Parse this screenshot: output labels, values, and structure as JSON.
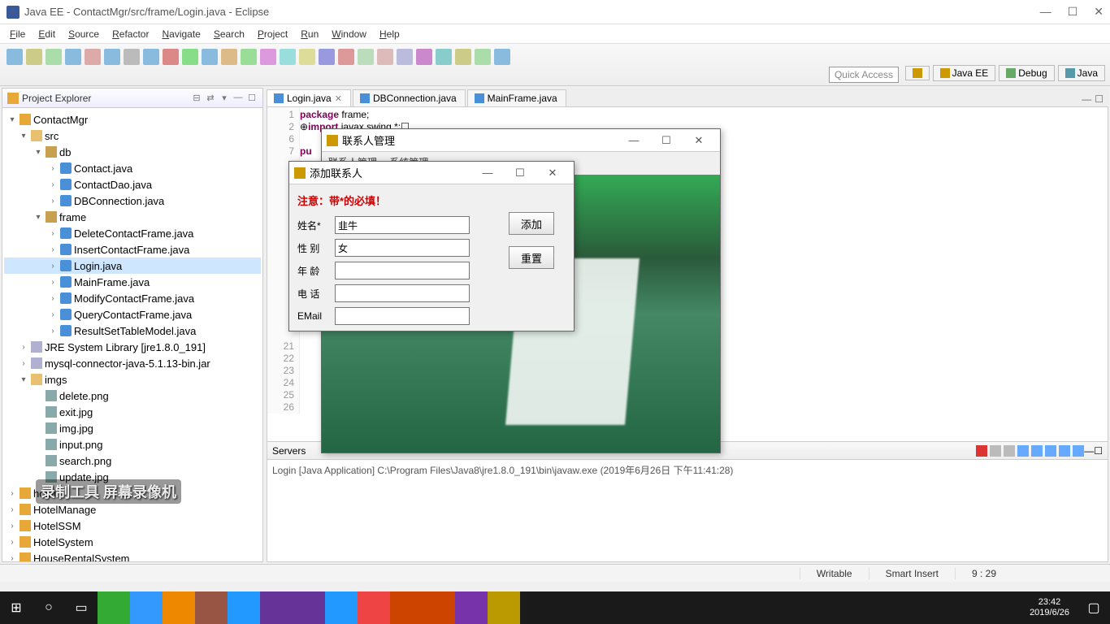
{
  "title": "Java EE - ContactMgr/src/frame/Login.java - Eclipse",
  "menus": [
    "File",
    "Edit",
    "Source",
    "Refactor",
    "Navigate",
    "Search",
    "Project",
    "Run",
    "Window",
    "Help"
  ],
  "quick_access": "Quick Access",
  "perspectives": {
    "javaee": "Java EE",
    "debug": "Debug",
    "java": "Java"
  },
  "explorer": {
    "title": "Project Explorer",
    "tree": [
      {
        "depth": 0,
        "icon": "project",
        "arrow": "▾",
        "label": "ContactMgr"
      },
      {
        "depth": 1,
        "icon": "folder",
        "arrow": "▾",
        "label": "src"
      },
      {
        "depth": 2,
        "icon": "pkg",
        "arrow": "▾",
        "label": "db"
      },
      {
        "depth": 3,
        "icon": "java",
        "arrow": "›",
        "label": "Contact.java"
      },
      {
        "depth": 3,
        "icon": "java",
        "arrow": "›",
        "label": "ContactDao.java"
      },
      {
        "depth": 3,
        "icon": "java",
        "arrow": "›",
        "label": "DBConnection.java"
      },
      {
        "depth": 2,
        "icon": "pkg",
        "arrow": "▾",
        "label": "frame"
      },
      {
        "depth": 3,
        "icon": "java",
        "arrow": "›",
        "label": "DeleteContactFrame.java"
      },
      {
        "depth": 3,
        "icon": "java",
        "arrow": "›",
        "label": "InsertContactFrame.java"
      },
      {
        "depth": 3,
        "icon": "java",
        "arrow": "›",
        "label": "Login.java",
        "selected": true
      },
      {
        "depth": 3,
        "icon": "java",
        "arrow": "›",
        "label": "MainFrame.java"
      },
      {
        "depth": 3,
        "icon": "java",
        "arrow": "›",
        "label": "ModifyContactFrame.java"
      },
      {
        "depth": 3,
        "icon": "java",
        "arrow": "›",
        "label": "QueryContactFrame.java"
      },
      {
        "depth": 3,
        "icon": "java",
        "arrow": "›",
        "label": "ResultSetTableModel.java"
      },
      {
        "depth": 1,
        "icon": "jar",
        "arrow": "›",
        "label": "JRE System Library [jre1.8.0_191]"
      },
      {
        "depth": 1,
        "icon": "jar",
        "arrow": "›",
        "label": "mysql-connector-java-5.1.13-bin.jar"
      },
      {
        "depth": 1,
        "icon": "folder",
        "arrow": "▾",
        "label": "imgs"
      },
      {
        "depth": 2,
        "icon": "img",
        "arrow": "",
        "label": "delete.png"
      },
      {
        "depth": 2,
        "icon": "img",
        "arrow": "",
        "label": "exit.jpg"
      },
      {
        "depth": 2,
        "icon": "img",
        "arrow": "",
        "label": "img.jpg"
      },
      {
        "depth": 2,
        "icon": "img",
        "arrow": "",
        "label": "input.png"
      },
      {
        "depth": 2,
        "icon": "img",
        "arrow": "",
        "label": "search.png"
      },
      {
        "depth": 2,
        "icon": "img",
        "arrow": "",
        "label": "update.jpg"
      },
      {
        "depth": 0,
        "icon": "project",
        "arrow": "›",
        "label": "hotel"
      },
      {
        "depth": 0,
        "icon": "project",
        "arrow": "›",
        "label": "HotelManage"
      },
      {
        "depth": 0,
        "icon": "project",
        "arrow": "›",
        "label": "HotelSSM"
      },
      {
        "depth": 0,
        "icon": "project",
        "arrow": "›",
        "label": "HotelSystem"
      },
      {
        "depth": 0,
        "icon": "project",
        "arrow": "›",
        "label": "HouseRentalSystem"
      }
    ]
  },
  "editor": {
    "tabs": [
      {
        "label": "Login.java",
        "active": true
      },
      {
        "label": "DBConnection.java",
        "active": false
      },
      {
        "label": "MainFrame.java",
        "active": false
      }
    ],
    "lines": {
      "numbers": [
        "1",
        "2",
        "6",
        "7",
        "",
        "",
        "",
        "",
        "",
        "",
        "",
        "",
        "",
        "",
        "",
        "",
        "",
        "",
        "",
        "21",
        "22",
        "23",
        "24",
        "25",
        "26"
      ],
      "code": [
        {
          "plain": "",
          "kw": "package",
          "rest": " frame;"
        },
        {
          "plain": "⊕",
          "kw": "import",
          "rest": " javax.swing.*;☐"
        },
        {
          "plain": "",
          "kw": "",
          "rest": ""
        },
        {
          "plain": "",
          "kw": "pu",
          "rest": ""
        }
      ]
    }
  },
  "console": {
    "tab": "Servers",
    "text": "Login [Java Application] C:\\Program Files\\Java8\\jre1.8.0_191\\bin\\javaw.exe (2019年6月26日 下午11:41:28)"
  },
  "status": {
    "writable": "Writable",
    "insert": "Smart Insert",
    "pos": "9 : 29"
  },
  "taskbar": {
    "time": "23:42",
    "date": "2019/6/26"
  },
  "dlg1": {
    "title": "联系人管理",
    "menus": [
      "联系人管理",
      "系统管理"
    ]
  },
  "dlg2": {
    "title": "添加联系人",
    "note": "注意：带*的必填！",
    "fields": [
      {
        "label": "姓名*",
        "value": "韭牛"
      },
      {
        "label": "性 别",
        "value": "女"
      },
      {
        "label": "年 龄",
        "value": ""
      },
      {
        "label": "电 话",
        "value": ""
      },
      {
        "label": "EMail",
        "value": ""
      }
    ],
    "buttons": {
      "add": "添加",
      "reset": "重置"
    }
  },
  "watermark": "录制工具\n屏幕录像机"
}
